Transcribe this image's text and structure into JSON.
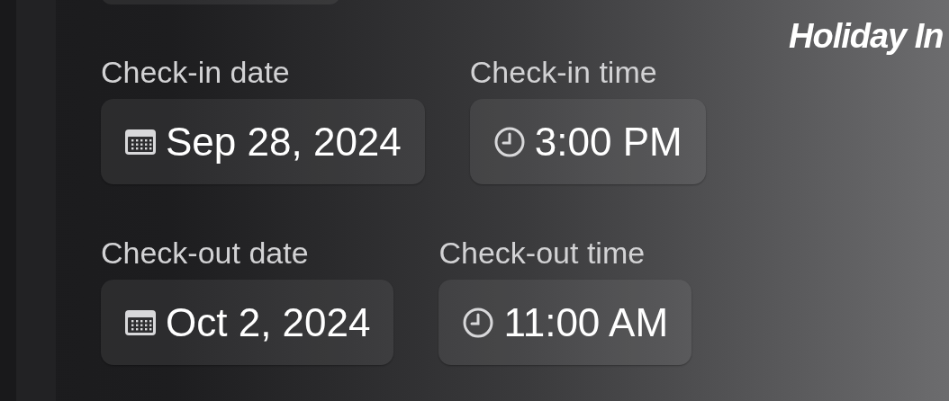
{
  "brand": {
    "text": "Holiday In"
  },
  "rows": [
    {
      "fields": [
        {
          "kind": "date",
          "label": "Check-in date",
          "value": "Sep 28, 2024"
        },
        {
          "kind": "time",
          "label": "Check-in time",
          "value": "3:00 PM"
        }
      ]
    },
    {
      "fields": [
        {
          "kind": "date",
          "label": "Check-out date",
          "value": "Oct 2, 2024"
        },
        {
          "kind": "time",
          "label": "Check-out time",
          "value": "11:00 AM"
        }
      ]
    }
  ]
}
